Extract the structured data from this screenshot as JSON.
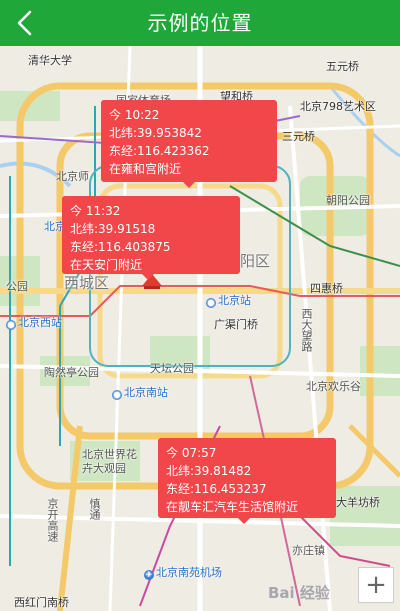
{
  "header": {
    "title": "示例的位置",
    "back_icon": "chevron-left-icon"
  },
  "colors": {
    "header_bg": "#1fa839",
    "callout_bg": "#f2474a",
    "subway_blue": "#2f7bd8"
  },
  "callouts": [
    {
      "time": "今 10:22",
      "lat": "北纬:39.953842",
      "lng": "东经:116.423362",
      "place": "在雍和宫附近"
    },
    {
      "time": "今 11:32",
      "lat": "北纬:39.91518",
      "lng": "东经:116.403875",
      "place": "在天安门附近"
    },
    {
      "time": "今 07:57",
      "lat": "北纬:39.81482",
      "lng": "东经:116.453237",
      "place": "在靓车汇汽车生活馆附近"
    }
  ],
  "map_labels": {
    "qinghua": "清华大学",
    "wudaokou": "五元桥",
    "guojia": "国家体育场",
    "wangheqiao": "望和桥",
    "art798": "北京798艺术区",
    "sanyuanqiao": "三元桥",
    "beijingshi": "北京师",
    "chaoyangpark": "朝阳公园",
    "beijingzoo": "北京",
    "district": "阳区",
    "sihuiqiao": "四惠桥",
    "xicheng": "西城区",
    "gongyuan": "公园",
    "beijingzhan": "北京站",
    "beijingxizhan": "北京西站",
    "guangqumen": "广渠门桥",
    "xidawang": "西大望路",
    "taoranting": "陶然亭公园",
    "tiantan": "天坛公园",
    "beijingnanzhan": "北京南站",
    "huanlegu": "北京欢乐谷",
    "shijiehua": "北京世界花卉大观园",
    "yizhuang": "大羊坊桥",
    "jingkai": "京开高速",
    "nanyuan": "北京南苑机场",
    "xihongmen": "西红门南桥",
    "yizhuang2": "亦庄镇",
    "tiangong": "慎通",
    "watermark": "Bai 经验"
  },
  "zoom_label": "+"
}
